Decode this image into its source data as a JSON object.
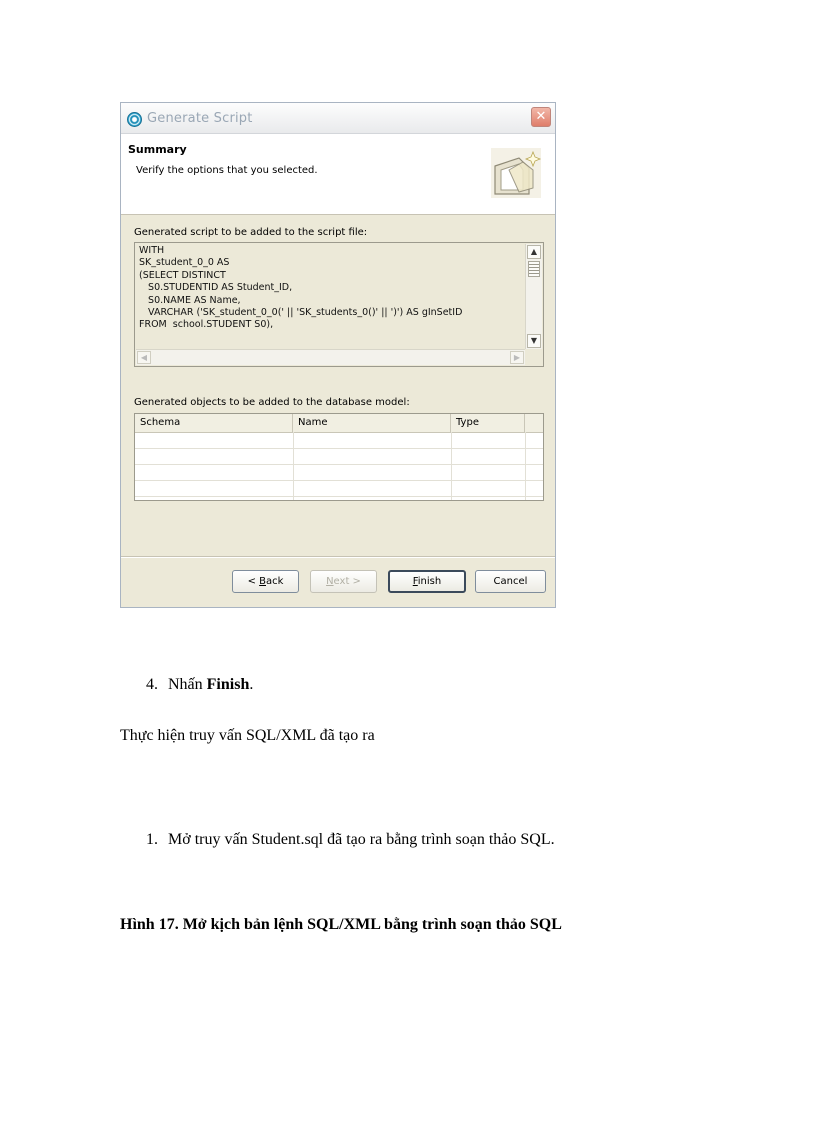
{
  "dialog": {
    "title": "Generate Script",
    "close_glyph": "✕",
    "summary_title": "Summary",
    "summary_description": "Verify the options that you selected.",
    "script_label": "Generated script to be added to the script file:",
    "script_lines": [
      "WITH",
      "SK_student_0_0 AS",
      "(SELECT DISTINCT",
      "   S0.STUDENTID AS Student_ID,",
      "   S0.NAME AS Name,",
      "   VARCHAR ('SK_student_0_0(' || 'SK_students_0()' || ')') AS gInSetID",
      "FROM  school.STUDENT S0),"
    ],
    "objects_label": "Generated objects to be added to the database model:",
    "table_columns": [
      "Schema",
      "Name",
      "Type"
    ],
    "buttons": {
      "back": {
        "prefix": "< ",
        "mnemonic": "B",
        "rest": "ack"
      },
      "next": {
        "mnemonic": "N",
        "rest": "ext >"
      },
      "finish": {
        "mnemonic": "F",
        "rest": "inish"
      },
      "cancel": "Cancel"
    },
    "icons": {
      "app": "wizard-app-icon",
      "banner": "script-wizard-banner-icon",
      "close": "close-icon"
    }
  },
  "document": {
    "step4_number": "4.",
    "step4_text": "Nhấn ",
    "step4_bold": "Finish",
    "step4_end": ".",
    "section_heading": "Thực hiện truy vấn SQL/XML đã tạo ra",
    "step1_number": "1.",
    "step1_text": "Mở truy vấn Student.sql đã tạo ra bằng trình soạn thảo SQL.",
    "figure_caption": "Hình 17. Mở kịch bản lệnh SQL/XML bằng trình soạn thảo SQL"
  }
}
